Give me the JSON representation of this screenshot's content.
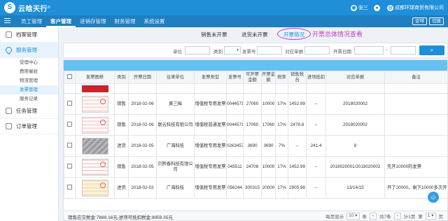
{
  "app": {
    "logo_mark": "S",
    "logo_text": "云晗天行",
    "logo_tm": "®"
  },
  "topbar": {
    "user_icon": "user-icon",
    "user_name": "张三",
    "notify_icon": "bell-icon",
    "company": "成都环球商贸有限公司"
  },
  "nav": {
    "items": [
      "员工管理",
      "客户管理",
      "进销存管理",
      "财务管理",
      "系统设置"
    ],
    "active_index": 1,
    "buttons": [
      "安啡",
      "切换"
    ]
  },
  "sidebar": {
    "groups": [
      {
        "label": "档案管理",
        "icon": "archive-icon"
      },
      {
        "label": "服务管理",
        "icon": "heart-icon"
      },
      {
        "label": "任务管理",
        "icon": "task-icon"
      },
      {
        "label": "订单管理",
        "icon": "order-icon"
      }
    ],
    "service_subitems": [
      "受理中心",
      "费用催收",
      "物流管理",
      "发票管理",
      "服务记录"
    ],
    "active_sub": 3
  },
  "tabs": [
    "销售未开票",
    "进货未开票",
    "开票情况"
  ],
  "active_tab": 2,
  "annotation": "开票总体情况查看",
  "filters": {
    "unit_label": "单位",
    "category_label": "类别",
    "category_value": "",
    "invoice_no_label": "发票号",
    "doc_label": "对应单据",
    "date_label": "开票日期",
    "date_sep": "-",
    "search_icon": "search-icon"
  },
  "table": {
    "headers": [
      "发票图样",
      "类别",
      "开票日期",
      "往来单位",
      "发票类型",
      "发票号",
      "可开票金额",
      "开票金额",
      "税率",
      "销售税合",
      "进项抵扣",
      "对应单据",
      "备注"
    ],
    "rows": [
      {
        "thumb": "t-strip",
        "category": "",
        "date": "",
        "unit": "",
        "type": "",
        "no": "",
        "avail": "",
        "amount": "",
        "rate": "",
        "sales_tax": "",
        "deduct": "",
        "doc": "",
        "note": "",
        "partial": true
      },
      {
        "thumb": "t-red",
        "category": "销售",
        "date": "2018-02-06",
        "unit": "黄三梅",
        "type": "增值税专用发票",
        "no": "00445711",
        "avail": "27060",
        "amount": "10000",
        "rate": "17%",
        "sales_tax": "1452.99",
        "deduct": "--",
        "doc": "2018020002",
        "note": ""
      },
      {
        "thumb": "t-red",
        "category": "销售",
        "date": "2018-02-06",
        "unit": "联云科技有限公司",
        "type": "增值税普通发票",
        "no": "00445711",
        "avail": "17060",
        "amount": "17060",
        "rate": "17%",
        "sales_tax": "2478.8",
        "deduct": "--",
        "doc": "2018020002",
        "note": ""
      },
      {
        "thumb": "t-gray",
        "category": "进货",
        "date": "2018-02-05",
        "unit": "广海科技",
        "type": "增值税专用发票",
        "no": "02634571",
        "avail": "3690",
        "amount": "3690",
        "rate": "7%",
        "sales_tax": "--",
        "deduct": "241.4",
        "doc": "8",
        "note": ""
      },
      {
        "thumb": "t-pink",
        "category": "销售",
        "date": "2018-02-05",
        "unit": "贝黔春科技有限公司",
        "type": "增值税专用发票",
        "no": "045511",
        "avail": "24708",
        "amount": "10000",
        "rate": "17%",
        "sales_tax": "1452.99",
        "deduct": "--",
        "doc": "2018020001/2018020002",
        "note": "先开10000的发票"
      },
      {
        "thumb": "t-beige",
        "category": "进货",
        "date": "2018-02-03",
        "unit": "广海科技",
        "type": "增值税专用发票",
        "no": "056244",
        "avail": "300315",
        "amount": "20000",
        "rate": "17%",
        "sales_tax": "2905.98",
        "deduct": "--",
        "doc": "13/14/15",
        "note": "开了20000，剩下10000多次开"
      }
    ]
  },
  "footer": {
    "summary": "销售应交税金:7889.16元,进项可抵扣税金:8959.35元",
    "per_page_label": "每页显示",
    "per_page": "10",
    "unit_label": "条",
    "total": "共7条",
    "pages": "计1页",
    "page_prefix": "第",
    "page": "1",
    "page_suffix": "页"
  },
  "float_button_icon": "chat-icon",
  "colors": {
    "primary": "#1e8fd8",
    "nav": "#1f7fc1",
    "accent": "#c23ccf",
    "toolbar": "#65c1f2"
  }
}
